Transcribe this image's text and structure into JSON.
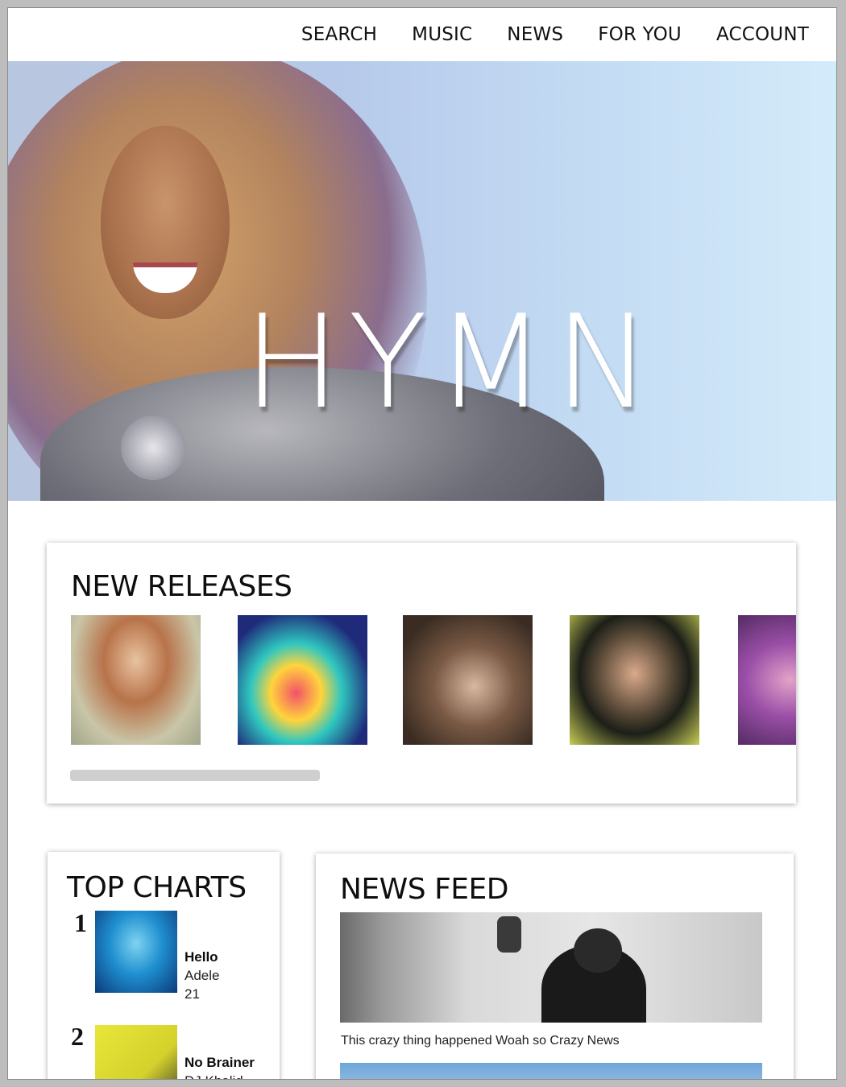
{
  "nav": {
    "items": [
      "SEARCH",
      "MUSIC",
      "NEWS",
      "FOR YOU",
      "ACCOUNT"
    ]
  },
  "hero": {
    "logo": "HYMN"
  },
  "new_releases": {
    "title": "NEW RELEASES"
  },
  "top_charts": {
    "title": "TOP CHARTS",
    "entries": [
      {
        "rank": "1",
        "song": "Hello",
        "artist": "Adele",
        "album": "21"
      },
      {
        "rank": "2",
        "song": "No Brainer",
        "artist": "DJ Khalid",
        "album": ""
      }
    ]
  },
  "news_feed": {
    "title": "NEWS FEED",
    "items": [
      {
        "caption": "This crazy thing happened Woah so Crazy News"
      }
    ]
  },
  "colors": {
    "page_background": "#ffffff",
    "frame": "#bdbdbd",
    "scrollbar": "#cfcfcf",
    "text": "#111111"
  }
}
